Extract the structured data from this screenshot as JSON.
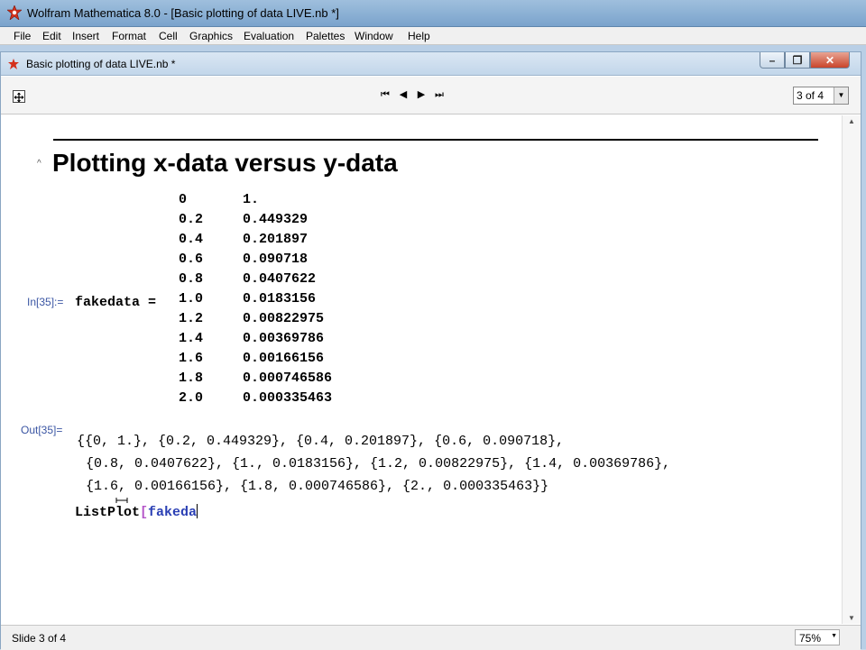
{
  "app": {
    "title": "Wolfram Mathematica 8.0 - [Basic plotting of data LIVE.nb *]"
  },
  "menu": [
    "File",
    "Edit",
    "Insert",
    "Format",
    "Cell",
    "Graphics",
    "Evaluation",
    "Palettes",
    "Window",
    "Help"
  ],
  "document": {
    "title": "Basic plotting of data LIVE.nb *",
    "window_buttons": {
      "minimize": "–",
      "restore": "❐",
      "close": "✕"
    }
  },
  "slide_nav": {
    "first": "⏮",
    "prev": "◀",
    "next": "▶",
    "last": "⏭",
    "selector_value": "3 of 4",
    "selector_arrow": "▼"
  },
  "notebook": {
    "section_title": "Plotting x-data versus y-data",
    "in_label": "In[35]:=",
    "assign_text": "fakedata =",
    "matrix": [
      {
        "x": "0",
        "y": "1."
      },
      {
        "x": "0.2",
        "y": "0.449329"
      },
      {
        "x": "0.4",
        "y": "0.201897"
      },
      {
        "x": "0.6",
        "y": "0.090718"
      },
      {
        "x": "0.8",
        "y": "0.0407622"
      },
      {
        "x": "1.0",
        "y": "0.0183156"
      },
      {
        "x": "1.2",
        "y": "0.00822975"
      },
      {
        "x": "1.4",
        "y": "0.00369786"
      },
      {
        "x": "1.6",
        "y": "0.00166156"
      },
      {
        "x": "1.8",
        "y": "0.000746586"
      },
      {
        "x": "2.0",
        "y": "0.000335463"
      }
    ],
    "out_label": "Out[35]=",
    "output_lines": [
      "{{0, 1.}, {0.2, 0.449329}, {0.4, 0.201897}, {0.6, 0.090718},",
      "{0.8, 0.0407622}, {1., 0.0183156}, {1.2, 0.00822975}, {1.4, 0.00369786},",
      "{1.6, 0.00166156}, {1.8, 0.000746586}, {2., 0.000335463}}"
    ],
    "input_fn": "ListPlot",
    "input_bracket": "[",
    "input_arg": "fakeda"
  },
  "status": {
    "text": "Slide 3 of 4",
    "zoom": "75%"
  }
}
